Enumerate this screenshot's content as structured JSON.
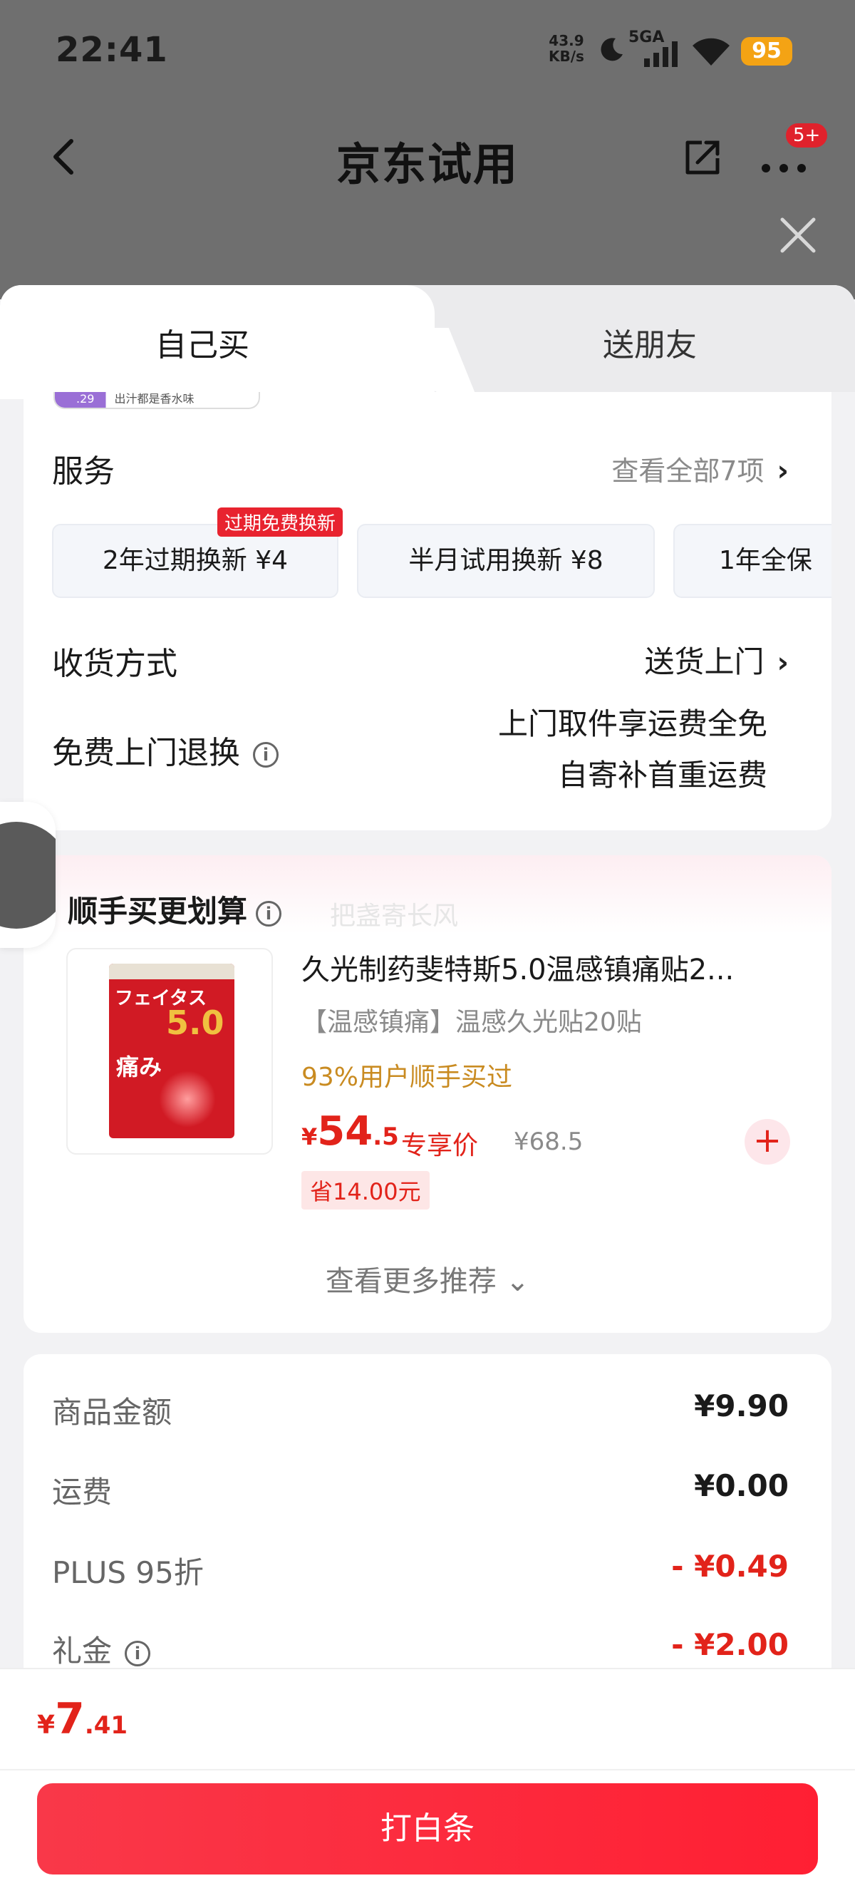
{
  "status_bar": {
    "time": "22:41",
    "speed_top": "43.9",
    "speed_unit": "KB/s",
    "network": "5GA",
    "battery": "95"
  },
  "nav": {
    "title": "京东试用",
    "badge": "5+"
  },
  "tabs": {
    "self": "自己买",
    "friend": "送朋友"
  },
  "promo_sliver": {
    "price": ".29",
    "text": "出汁都是香水味"
  },
  "services": {
    "label": "服务",
    "view_all": "查看全部7项",
    "chips": [
      {
        "label": "2年过期换新  ¥4",
        "tag": "过期免费换新"
      },
      {
        "label": "半月试用换新  ¥8"
      },
      {
        "label": "1年全保"
      }
    ]
  },
  "delivery": {
    "label": "收货方式",
    "value": "送货上门"
  },
  "return": {
    "label": "免费上门退换",
    "line1": "上门取件享运费全免",
    "line2": "自寄补首重运费"
  },
  "recommend": {
    "title": "顺手买更划算",
    "watermark": "把盏寄长风",
    "product": {
      "name": "久光制药斐特斯5.0温感镇痛贴2...",
      "subtitle": "【温感镇痛】温感久光贴20贴",
      "stat": "93%用户顺手买过",
      "price_currency": "¥",
      "price_int": "54",
      "price_dec": ".5",
      "price_label": "专享价",
      "original_price": "¥68.5",
      "save": "省14.00元",
      "box_brand": "フェイタス",
      "box_num": "5.0",
      "box_pain": "痛み"
    },
    "more": "查看更多推荐 ⌄"
  },
  "summary": {
    "rows": [
      {
        "label": "商品金额",
        "value": "¥9.90"
      },
      {
        "label": "运费",
        "value": "¥0.00"
      },
      {
        "label": "PLUS 95折",
        "value": "- ¥0.49"
      },
      {
        "label": "礼金",
        "value": "- ¥2.00"
      }
    ]
  },
  "bottom": {
    "currency": "¥",
    "total_int": "7",
    "total_dec": ".41",
    "pay_label": "打白条"
  },
  "colors": {
    "accent_red": "#e2231a",
    "pay_button": "#ff1f33",
    "stat_orange": "#c98b21",
    "battery": "#f4a314"
  }
}
